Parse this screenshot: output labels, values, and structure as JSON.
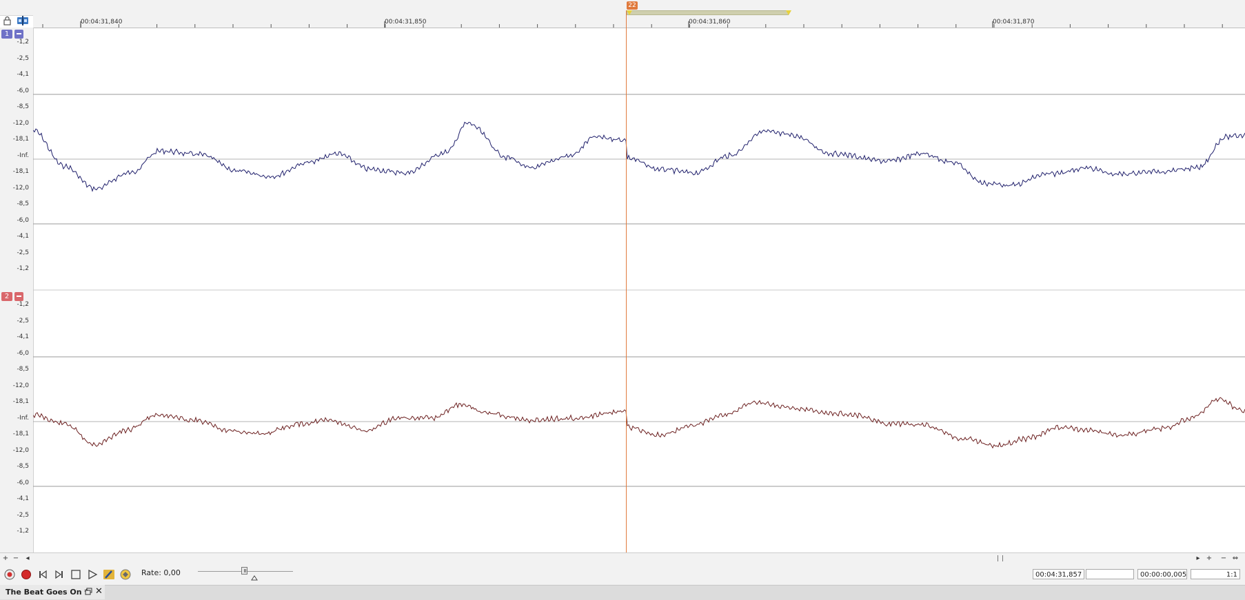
{
  "marker": {
    "number": "22"
  },
  "ruler": {
    "labels": [
      "00:04:31,840",
      "00:04:31,850",
      "00:04:31,860",
      "00:04:31,870"
    ]
  },
  "channels": [
    {
      "number": "1",
      "badge_color": "#6f72c7",
      "wave_color": "#1f1f6b",
      "scale_labels": [
        "-1,2",
        "-2,5",
        "-4,1",
        "-6,0",
        "-8,5",
        "-12,0",
        "-18,1",
        "-Inf.",
        "-18,1",
        "-12,0",
        "-8,5",
        "-6,0",
        "-4,1",
        "-2,5",
        "-1,2"
      ]
    },
    {
      "number": "2",
      "badge_color": "#d9676b",
      "wave_color": "#6b1f1f",
      "scale_labels": [
        "-1,2",
        "-2,5",
        "-4,1",
        "-6,0",
        "-8,5",
        "-12,0",
        "-18,1",
        "-Inf.",
        "-18,1",
        "-12,0",
        "-8,5",
        "-6,0",
        "-4,1",
        "-2,5",
        "-1,2"
      ]
    }
  ],
  "colors": {
    "cursor": "#e07a3d",
    "gridline": "#9a9a9a"
  },
  "scrollbar": {
    "zoom_in": "+",
    "zoom_out": "−"
  },
  "transport": {
    "rate_label": "Rate: 0,00",
    "rate": 0.0,
    "cursor_time": "00:04:31,857",
    "selection_end": "",
    "selection_length": "00:00:00,005",
    "zoom_ratio": "1:1",
    "icons": [
      "record-arm-icon",
      "record-icon",
      "go-to-start-icon",
      "go-to-end-icon",
      "stop-icon",
      "play-icon",
      "pencil-tool-icon",
      "envelope-tool-icon"
    ]
  },
  "document": {
    "tab_title": "The Beat Goes On *",
    "close_glyph": "✕"
  }
}
